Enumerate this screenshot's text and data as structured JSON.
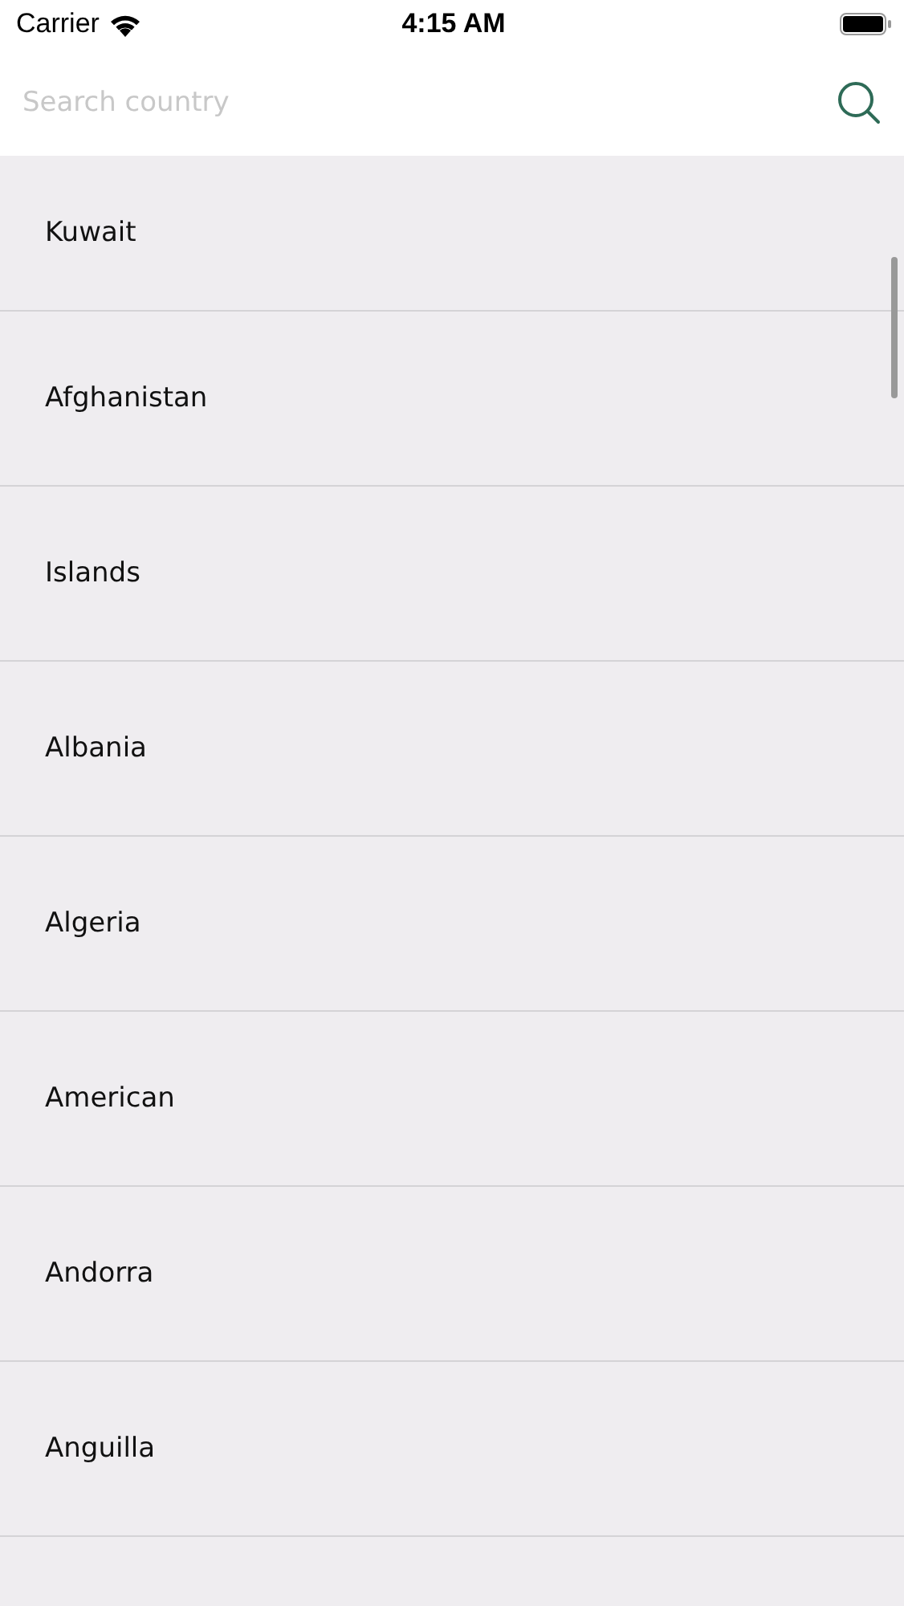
{
  "status_bar": {
    "carrier": "Carrier",
    "time": "4:15 AM"
  },
  "search": {
    "placeholder": "Search country"
  },
  "countries": [
    {
      "name": "Kuwait"
    },
    {
      "name": "Afghanistan"
    },
    {
      "name": "Islands"
    },
    {
      "name": "Albania"
    },
    {
      "name": "Algeria"
    },
    {
      "name": "American"
    },
    {
      "name": "Andorra"
    },
    {
      "name": "Anguilla"
    }
  ]
}
